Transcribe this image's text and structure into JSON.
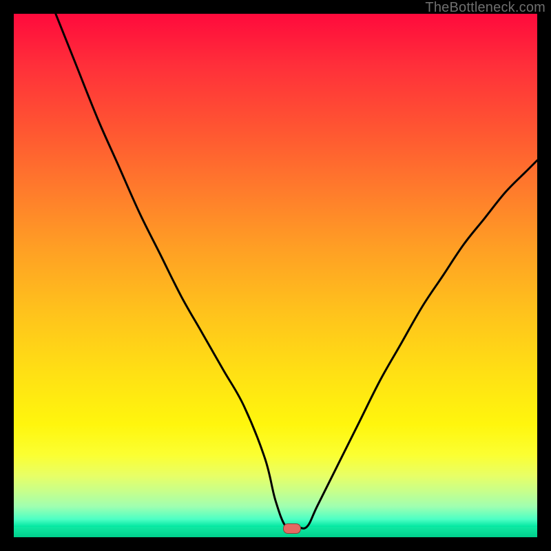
{
  "watermark": {
    "text": "TheBottleneck.com"
  },
  "marker": {
    "x_pct": 53,
    "y_pct": 98.2
  },
  "colors": {
    "background": "#000000",
    "curve_stroke": "#000000",
    "marker_fill": "#e36a62"
  },
  "chart_data": {
    "type": "line",
    "title": "",
    "xlabel": "",
    "ylabel": "",
    "xlim": [
      0,
      100
    ],
    "ylim": [
      0,
      100
    ],
    "grid": false,
    "series": [
      {
        "name": "bottleneck-curve",
        "x": [
          8,
          12,
          16,
          20,
          24,
          28,
          32,
          36,
          40,
          44,
          48,
          50,
          52,
          54,
          56,
          58,
          62,
          66,
          70,
          74,
          78,
          82,
          86,
          90,
          94,
          98,
          100
        ],
        "y": [
          100,
          90,
          80,
          71,
          62,
          54,
          46,
          39,
          32,
          25,
          15,
          7,
          2,
          2,
          2,
          6,
          14,
          22,
          30,
          37,
          44,
          50,
          56,
          61,
          66,
          70,
          72
        ]
      }
    ],
    "marker": {
      "x": 53,
      "y": 2
    },
    "background_gradient": {
      "top": "#ff0a3c",
      "mid": "#ffe014",
      "bottom": "#00cf8c"
    }
  }
}
